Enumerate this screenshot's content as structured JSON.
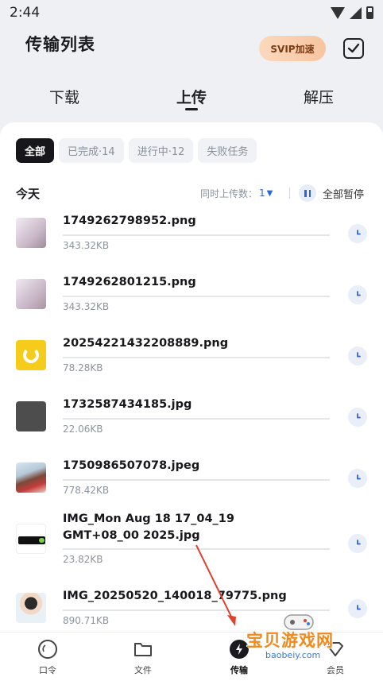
{
  "status_bar": {
    "time": "2:44"
  },
  "header": {
    "title": "传输列表",
    "svip_label": "SVIP加速"
  },
  "tabs": [
    {
      "label": "下载"
    },
    {
      "label": "上传"
    },
    {
      "label": "解压"
    }
  ],
  "filters": [
    {
      "label": "全部"
    },
    {
      "label": "已完成·14"
    },
    {
      "label": "进行中·12"
    },
    {
      "label": "失败任务"
    }
  ],
  "section": {
    "title": "今天",
    "concurrent_label": "同时上传数：",
    "concurrent_value": "1",
    "pause_all_label": "全部暂停"
  },
  "files": [
    {
      "name": "1749262798952.png",
      "size": "343.32KB"
    },
    {
      "name": "1749262801215.png",
      "size": "343.32KB"
    },
    {
      "name": "20254221432208889.png",
      "size": "78.28KB"
    },
    {
      "name": "1732587434185.jpg",
      "size": "22.06KB"
    },
    {
      "name": "1750986507078.jpeg",
      "size": "778.42KB"
    },
    {
      "name": "IMG_Mon Aug 18 17_04_19 GMT+08_00 2025.jpg",
      "size": "23.82KB"
    },
    {
      "name": "IMG_20250520_140018_79775.png",
      "size": "890.71KB"
    }
  ],
  "bottom_nav": [
    {
      "label": "口令",
      "icon": "circle-icon"
    },
    {
      "label": "文件",
      "icon": "folder-icon"
    },
    {
      "label": "传输",
      "icon": "bolt-icon"
    },
    {
      "label": "会员",
      "icon": "member-icon"
    }
  ],
  "watermark": {
    "text": "宝贝游戏网",
    "sub": "baobeiy.com"
  },
  "colors": {
    "accent": "#2d64d8",
    "svip_bg": "#f8c4a0",
    "active_chip": "#17171b"
  }
}
